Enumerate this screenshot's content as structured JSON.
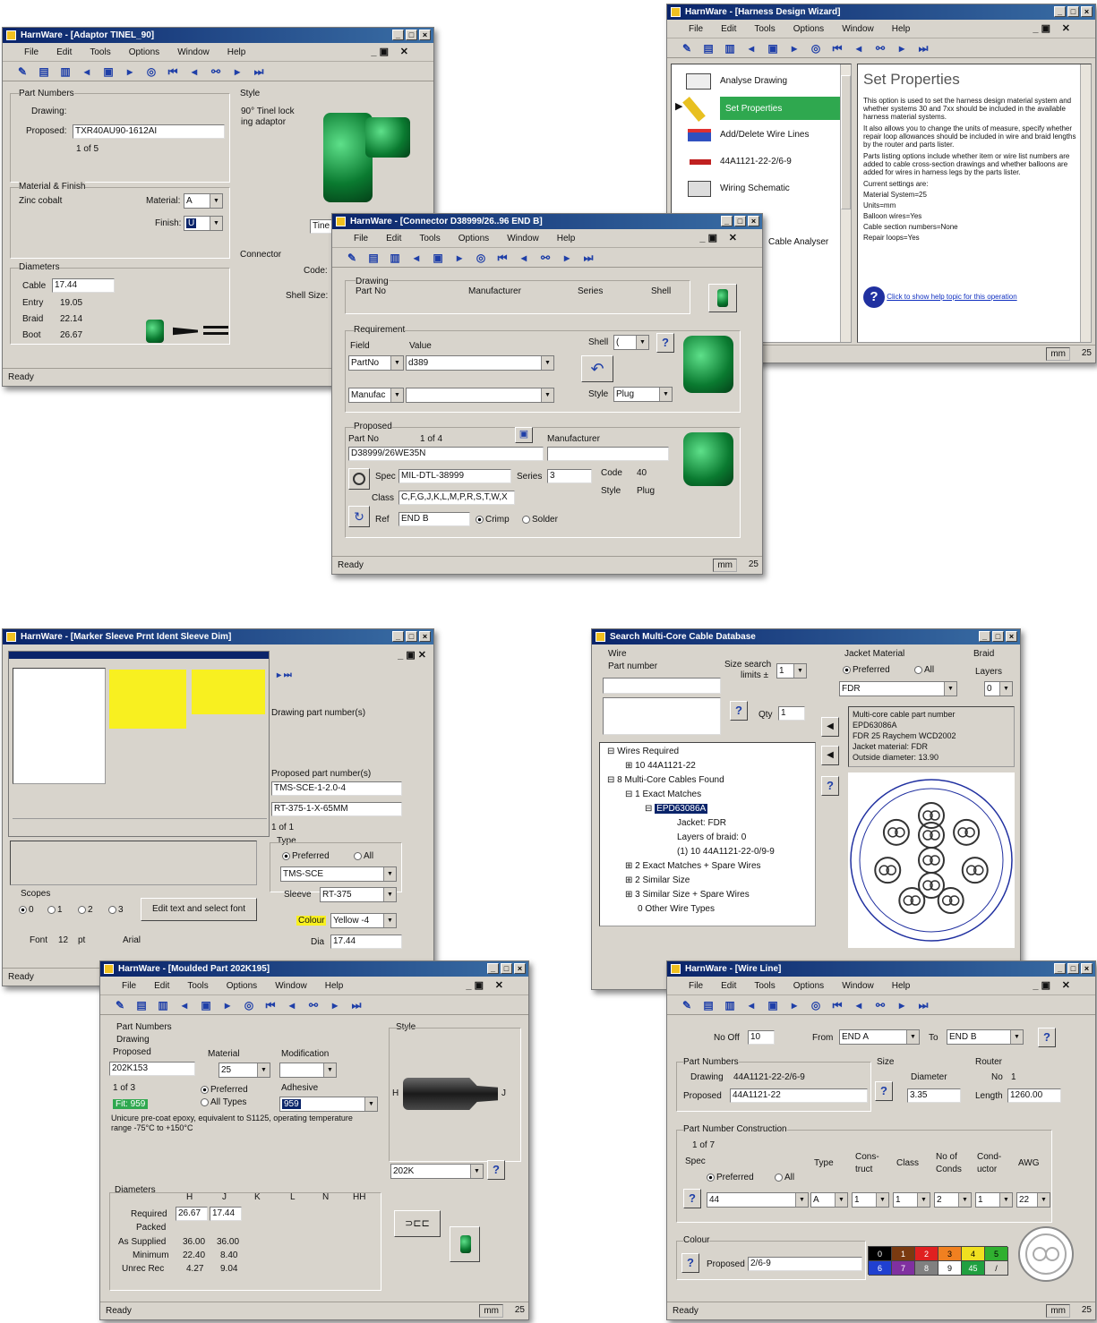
{
  "adaptor": {
    "title": "HarnWare - [Adaptor TINEL_90]",
    "menu": [
      "File",
      "Edit",
      "Tools",
      "Options",
      "Window",
      "Help"
    ],
    "part_numbers": "Part Numbers",
    "drawing": "Drawing:",
    "proposed_label": "Proposed:",
    "proposed_value": "TXR40AU90-1612AI",
    "count": "1 of 5",
    "style_label": "Style",
    "style_text1": "90° Tinel lock",
    "style_text2": "ing adaptor",
    "material_finish": "Material & Finish",
    "zinc": "Zinc cobalt",
    "material_label": "Material:",
    "material_value": "A",
    "finish_label": "Finish:",
    "finish_value": "U",
    "tine_field": "Tine",
    "connector": "Connector",
    "code": "Code:",
    "shell_size": "Shell Size:",
    "diameters": "Diameters",
    "cable_label": "Cable",
    "cable_value": "17.44",
    "entry_label": "Entry",
    "entry_value": "19.05",
    "braid_label": "Braid",
    "braid_value": "22.14",
    "boot_label": "Boot",
    "boot_value": "26.67",
    "status": "Ready"
  },
  "wizard": {
    "title": "HarnWare - [Harness Design Wizard]",
    "menu": [
      "File",
      "Edit",
      "Tools",
      "Options",
      "Window",
      "Help"
    ],
    "steps": [
      "Analyse Drawing",
      "Set Properties",
      "Add/Delete Wire Lines",
      "44A1121-22-2/6-9",
      "Wiring Schematic",
      "Cable Analyser"
    ],
    "heading": "Set Properties",
    "para1": "This option is used to set the harness design material system and whether systems 30 and 7xx should be included in the available harness material systems.",
    "para2": "It also allows you to change the units of measure, specify whether repair loop allowances should be included in wire and braid lengths by the router and parts lister.",
    "para3": "Parts listing options include whether item or wire list numbers are added to cable cross-section drawings and whether balloons are added for wires in harness legs by the parts lister.",
    "current": "Current settings are:",
    "s1": "Material System=25",
    "s2": "Units=mm",
    "s3": "Balloon wires=Yes",
    "s4": "Cable section numbers=None",
    "s5": "Repair loops=Yes",
    "help_link": "Click to show help topic for this operation",
    "sb_mm": "mm",
    "sb_25": "25"
  },
  "connector": {
    "title": "HarnWare - [Connector D38999/26..96 END B]",
    "menu": [
      "File",
      "Edit",
      "Tools",
      "Options",
      "Window",
      "Help"
    ],
    "drawing_part": "Drawing",
    "part_no": "Part No",
    "manufacturer": "Manufacturer",
    "series": "Series",
    "shell": "Shell",
    "requirement": "Requirement",
    "field": "Field",
    "value": "Value",
    "field_value": "PartNo",
    "value_value": "d389",
    "manufac": "Manufac",
    "shell_label": "Shell",
    "shell_value": "(",
    "style_label": "Style",
    "style_value": "Plug",
    "proposed": "Proposed",
    "partno_label": "Part No",
    "count": "1 of 4",
    "manufacturer2": "Manufacturer",
    "proposed_value": "D38999/26WE35N",
    "spec_label": "Spec",
    "spec_value": "MIL-DTL-38999",
    "series_label": "Series",
    "series_value": "3",
    "code_label": "Code",
    "code_value": "40",
    "style2_label": "Style",
    "style2_value": "Plug",
    "class_label": "Class",
    "class_value": "C,F,G,J,K,L,M,P,R,S,T,W,X",
    "ref_label": "Ref",
    "ref_value": "END B",
    "crimp": "Crimp",
    "solder": "Solder",
    "status": "Ready",
    "sb_mm": "mm",
    "sb_25": "25"
  },
  "marker": {
    "title": "HarnWare - [Marker Sleeve Prnt Ident Sleeve Dim]",
    "drawing_part": "Drawing part number(s)",
    "proposed_part": "Proposed part number(s)",
    "pp1": "TMS-SCE-1-2.0-4",
    "pp2": "RT-375-1-X-65MM",
    "count": "1 of 1",
    "type": "Type",
    "preferred": "Preferred",
    "all": "All",
    "type_value": "TMS-SCE",
    "sleeve_label": "Sleeve",
    "sleeve_value": "RT-375",
    "colour_label": "Colour",
    "colour_value": "Yellow -4",
    "dia_label": "Dia",
    "dia_value": "17.44",
    "scopes": "Scopes",
    "s0": "0",
    "s1": "1",
    "s2": "2",
    "s3": "3",
    "edit_btn": "Edit text and select font",
    "font_label": "Font",
    "font_size": "12",
    "font_unit": "pt",
    "font_name": "Arial",
    "status": "Ready"
  },
  "search": {
    "title": "Search Multi-Core Cable Database",
    "wire": "Wire",
    "part_number": "Part number",
    "size_search": "Size search",
    "limits": "limits ±",
    "limits_value": "1",
    "qty_label": "Qty",
    "qty_value": "1",
    "jacket_material": "Jacket Material",
    "preferred": "Preferred",
    "all": "All",
    "jacket_value": "FDR",
    "braid": "Braid",
    "layers": "Layers",
    "layers_value": "0",
    "info": [
      "Multi-core cable part number",
      "EPD63086A",
      "FDR 25 Raychem WCD2002",
      "Jacket material: FDR",
      "Outside diameter: 13.90"
    ],
    "tree": [
      "Wires Required",
      "10  44A1121-22",
      "8  Multi-Core Cables Found",
      "1  Exact Matches",
      "EPD63086A",
      "Jacket: FDR",
      "Layers of braid: 0",
      "(1) 10  44A1121-22-0/9-9",
      "2  Exact Matches + Spare Wires",
      "2  Similar Size",
      "3  Similar Size + Spare Wires",
      "0  Other Wire Types"
    ]
  },
  "moulded": {
    "title": "HarnWare - [Moulded Part 202K195]",
    "menu": [
      "File",
      "Edit",
      "Tools",
      "Options",
      "Window",
      "Help"
    ],
    "part_numbers": "Part Numbers",
    "drawing": "Drawing",
    "proposed": "Proposed",
    "proposed_value": "202K153",
    "count": "1 of 3",
    "badge": "Fit: 959",
    "material": "Material",
    "material_value": "25",
    "modification": "Modification",
    "preferred": "Preferred",
    "all_types": "All Types",
    "adhesive": "Adhesive",
    "adhesive_value": "959",
    "style": "Style",
    "desc": "Unicure pre-coat epoxy, equivalent to S1125, operating temperature range -75°C to +150°C",
    "style_value": "202K",
    "h": "H",
    "j": "J",
    "diameters": "Diameters",
    "cols": [
      "H",
      "J",
      "K",
      "L",
      "N",
      "HH"
    ],
    "required": "Required",
    "req_h": "26.67",
    "req_j": "17.44",
    "packed": "Packed",
    "as_supplied": "As Supplied",
    "as_h": "36.00",
    "as_j": "36.00",
    "minimum": "Minimum",
    "min_h": "22.40",
    "min_j": "8.40",
    "unrec": "Unrec Rec",
    "ur_h": "4.27",
    "ur_j": "9.04",
    "status": "Ready",
    "sb_mm": "mm",
    "sb_25": "25"
  },
  "wireline": {
    "title": "HarnWare - [Wire Line]",
    "menu": [
      "File",
      "Edit",
      "Tools",
      "Options",
      "Window",
      "Help"
    ],
    "no_off_label": "No Off",
    "no_off_value": "10",
    "from_label": "From",
    "from_value": "END A",
    "to_label": "To",
    "to_value": "END B",
    "part_numbers": "Part Numbers",
    "drawing_label": "Drawing",
    "drawing_value": "44A1121-22-2/6-9",
    "proposed_label": "Proposed",
    "proposed_value": "44A1121-22",
    "size": "Size",
    "diameter": "Diameter",
    "diameter_value": "3.35",
    "router": "Router",
    "no_label": "No",
    "no_value": "1",
    "length_label": "Length",
    "length_value": "1260.00",
    "pnc": "Part Number Construction",
    "count": "1 of 7",
    "spec": "Spec",
    "preferred": "Preferred",
    "all": "All",
    "type": "Type",
    "construct": "Cons-truct",
    "class": "Class",
    "no_of_conds": "No of Conds",
    "conductor": "Cond-uctor",
    "awg": "AWG",
    "spec_value": "44",
    "type_value": "A",
    "cons_value": "1",
    "class_value": "1",
    "conds_value": "2",
    "cond_value": "1",
    "awg_value": "22",
    "colour": "Colour",
    "proposed2": "Proposed",
    "colour_value": "2/6-9",
    "swatches": [
      {
        "t": "0",
        "c": "#000000",
        "f": "#fff"
      },
      {
        "t": "1",
        "c": "#7a3a10",
        "f": "#fff"
      },
      {
        "t": "2",
        "c": "#e02020",
        "f": "#fff"
      },
      {
        "t": "3",
        "c": "#f08020",
        "f": "#000"
      },
      {
        "t": "4",
        "c": "#f0e020",
        "f": "#000"
      },
      {
        "t": "5",
        "c": "#30b030",
        "f": "#000"
      },
      {
        "t": "6",
        "c": "#2040d0",
        "f": "#fff"
      },
      {
        "t": "7",
        "c": "#8030a0",
        "f": "#fff"
      },
      {
        "t": "8",
        "c": "#808080",
        "f": "#fff"
      },
      {
        "t": "9",
        "c": "#ffffff",
        "f": "#000"
      },
      {
        "t": "45",
        "c": "#20a040",
        "f": "#fff"
      },
      {
        "t": "/",
        "c": "#d8d4cc",
        "f": "#000"
      }
    ],
    "status": "Ready",
    "sb_mm": "mm",
    "sb_25": "25"
  },
  "shared": {
    "toolbar_icons": [
      "wand",
      "open",
      "save",
      "prev",
      "page",
      "next",
      "globe",
      "first",
      "back",
      "binoculars",
      "forward",
      "last"
    ]
  }
}
